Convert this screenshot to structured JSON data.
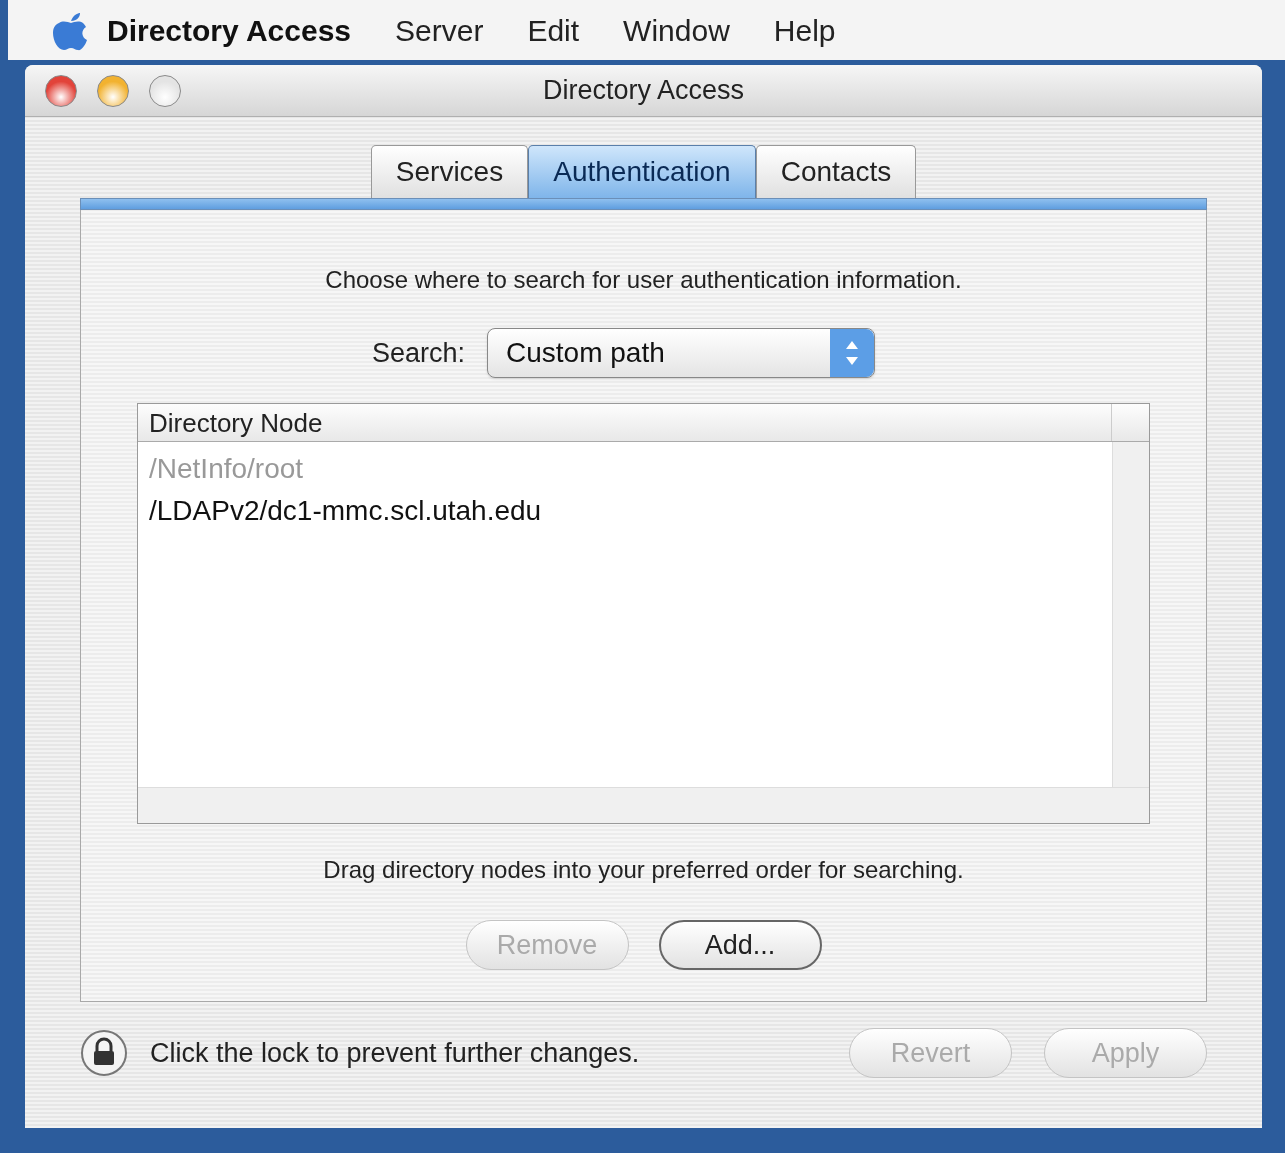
{
  "menu_bar": {
    "app_name": "Directory Access",
    "items": [
      "Server",
      "Edit",
      "Window",
      "Help"
    ]
  },
  "window": {
    "title": "Directory Access",
    "controls": [
      {
        "kind": "close",
        "disabled": false
      },
      {
        "kind": "minimize",
        "disabled": false
      },
      {
        "kind": "zoom",
        "disabled": true
      }
    ]
  },
  "tabs": [
    {
      "label": "Services",
      "selected": false
    },
    {
      "label": "Authentication",
      "selected": true
    },
    {
      "label": "Contacts",
      "selected": false
    }
  ],
  "instruction": "Choose where to search for user authentication information.",
  "search": {
    "label": "Search:",
    "value": "Custom path"
  },
  "table": {
    "columns": [
      "Directory Node"
    ],
    "rows": [
      {
        "text": "/NetInfo/root",
        "disabled": true
      },
      {
        "text": "/LDAPv2/dc1-mmc.scl.utah.edu",
        "disabled": false
      }
    ]
  },
  "hint": "Drag directory nodes into your preferred order for searching.",
  "buttons": [
    {
      "label": "Remove",
      "disabled": true
    },
    {
      "label": "Add...",
      "disabled": false
    }
  ],
  "lock": {
    "text": "Click the lock to prevent further changes."
  },
  "footer_buttons": [
    {
      "label": "Revert",
      "disabled": true
    },
    {
      "label": "Apply",
      "disabled": true
    }
  ]
}
